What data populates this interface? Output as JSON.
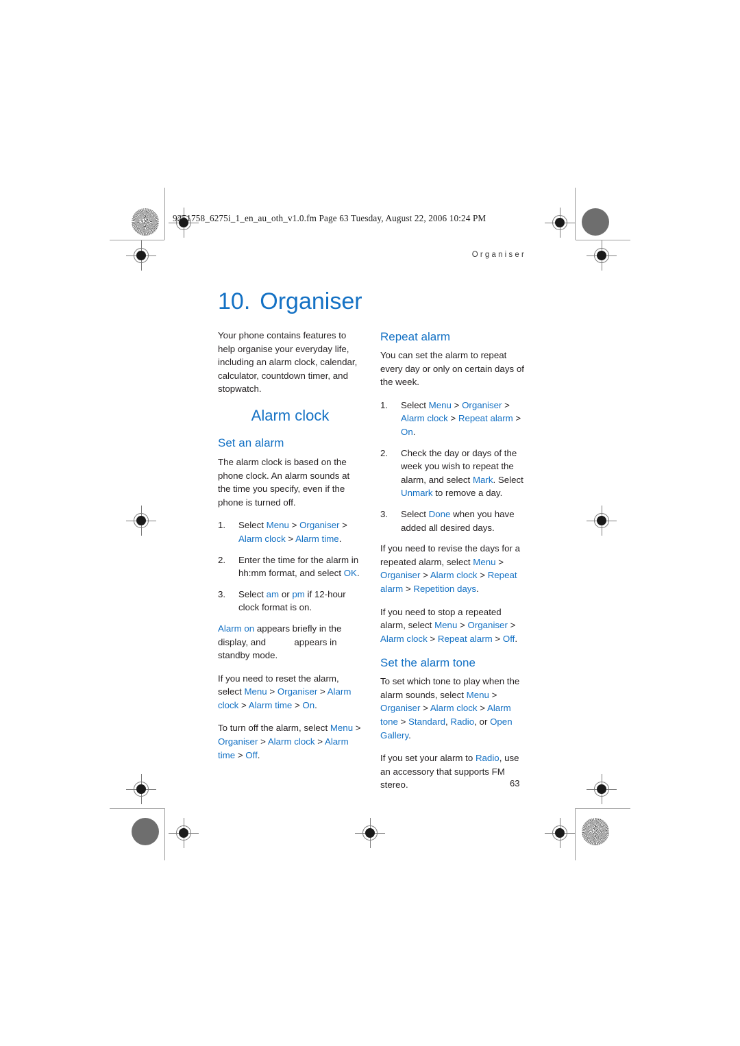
{
  "print_header": {
    "filename_line": "9251758_6275i_1_en_au_oth_v1.0.fm  Page 63  Tuesday, August 22, 2006  10:24 PM",
    "running_head": "Organiser"
  },
  "chapter": {
    "number": "10.",
    "title": "Organiser"
  },
  "left_column": {
    "intro": "Your phone contains features to help organise your everyday life, including an alarm clock, calendar, calculator, countdown timer, and stopwatch.",
    "section_heading": "Alarm clock",
    "sub_heading": "Set an alarm",
    "lead_paragraph": "The alarm clock is based on the phone clock. An alarm sounds at the time you specify, even if the phone is turned off.",
    "steps": [
      {
        "marker": "1.",
        "parts": [
          {
            "text": "Select ",
            "ui": false
          },
          {
            "text": "Menu",
            "ui": true
          },
          {
            "text": " > ",
            "ui": false
          },
          {
            "text": "Organiser",
            "ui": true
          },
          {
            "text": " > ",
            "ui": false
          },
          {
            "text": "Alarm clock",
            "ui": true
          },
          {
            "text": " > ",
            "ui": false
          },
          {
            "text": "Alarm time",
            "ui": true
          },
          {
            "text": ".",
            "ui": false
          }
        ]
      },
      {
        "marker": "2.",
        "parts": [
          {
            "text": "Enter the time for the alarm in hh:mm format, and select ",
            "ui": false
          },
          {
            "text": "OK",
            "ui": true
          },
          {
            "text": ".",
            "ui": false
          }
        ]
      },
      {
        "marker": "3.",
        "parts": [
          {
            "text": "Select ",
            "ui": false
          },
          {
            "text": "am",
            "ui": true
          },
          {
            "text": " or ",
            "ui": false
          },
          {
            "text": "pm",
            "ui": true
          },
          {
            "text": " if 12-hour clock format is on.",
            "ui": false
          }
        ]
      }
    ],
    "note_paragraph": [
      {
        "text": "Alarm on",
        "ui": true
      },
      {
        "text": " appears briefly in the display, and ",
        "ui": false
      },
      {
        "text": "",
        "ui": false,
        "icon_gap": true
      },
      {
        "text": " appears in standby mode.",
        "ui": false
      }
    ],
    "reset_paragraph": [
      {
        "text": "If you need to reset the alarm, select ",
        "ui": false
      },
      {
        "text": "Menu",
        "ui": true
      },
      {
        "text": " > ",
        "ui": false
      },
      {
        "text": "Organiser",
        "ui": true
      },
      {
        "text": " > ",
        "ui": false
      },
      {
        "text": "Alarm clock",
        "ui": true
      },
      {
        "text": " > ",
        "ui": false
      },
      {
        "text": "Alarm time",
        "ui": true
      },
      {
        "text": " > ",
        "ui": false
      },
      {
        "text": "On",
        "ui": true
      },
      {
        "text": ".",
        "ui": false
      }
    ],
    "turnoff_paragraph": [
      {
        "text": "To turn off the alarm, select ",
        "ui": false
      },
      {
        "text": "Menu",
        "ui": true
      },
      {
        "text": " > ",
        "ui": false
      },
      {
        "text": "Organiser",
        "ui": true
      },
      {
        "text": " > ",
        "ui": false
      },
      {
        "text": "Alarm clock",
        "ui": true
      },
      {
        "text": " > ",
        "ui": false
      },
      {
        "text": "Alarm time",
        "ui": true
      },
      {
        "text": " > ",
        "ui": false
      },
      {
        "text": "Off",
        "ui": true
      },
      {
        "text": ".",
        "ui": false
      }
    ]
  },
  "right_column": {
    "repeat_heading": "Repeat alarm",
    "repeat_intro": "You can set the alarm to repeat every day or only on certain days of the week.",
    "repeat_steps": [
      {
        "marker": "1.",
        "parts": [
          {
            "text": "Select ",
            "ui": false
          },
          {
            "text": "Menu",
            "ui": true
          },
          {
            "text": " > ",
            "ui": false
          },
          {
            "text": "Organiser",
            "ui": true
          },
          {
            "text": " > ",
            "ui": false
          },
          {
            "text": "Alarm clock",
            "ui": true
          },
          {
            "text": " > ",
            "ui": false
          },
          {
            "text": "Repeat alarm",
            "ui": true
          },
          {
            "text": " > ",
            "ui": false
          },
          {
            "text": "On",
            "ui": true
          },
          {
            "text": ".",
            "ui": false
          }
        ]
      },
      {
        "marker": "2.",
        "parts": [
          {
            "text": "Check the day or days of the week you wish to repeat the alarm, and select ",
            "ui": false
          },
          {
            "text": "Mark",
            "ui": true
          },
          {
            "text": ". Select ",
            "ui": false
          },
          {
            "text": "Unmark",
            "ui": true
          },
          {
            "text": " to remove a day.",
            "ui": false
          }
        ]
      },
      {
        "marker": "3.",
        "parts": [
          {
            "text": "Select ",
            "ui": false
          },
          {
            "text": "Done",
            "ui": true
          },
          {
            "text": " when you have added all desired days.",
            "ui": false
          }
        ]
      }
    ],
    "revise_paragraph": [
      {
        "text": "If you need to revise the days for a repeated alarm, select ",
        "ui": false
      },
      {
        "text": "Menu",
        "ui": true
      },
      {
        "text": " > ",
        "ui": false
      },
      {
        "text": "Organiser",
        "ui": true
      },
      {
        "text": " > ",
        "ui": false
      },
      {
        "text": "Alarm clock",
        "ui": true
      },
      {
        "text": " > ",
        "ui": false
      },
      {
        "text": "Repeat alarm",
        "ui": true
      },
      {
        "text": " > ",
        "ui": false
      },
      {
        "text": "Repetition days",
        "ui": true
      },
      {
        "text": ".",
        "ui": false
      }
    ],
    "stop_paragraph": [
      {
        "text": "If you need to stop a repeated alarm, select ",
        "ui": false
      },
      {
        "text": "Menu",
        "ui": true
      },
      {
        "text": " > ",
        "ui": false
      },
      {
        "text": "Organiser",
        "ui": true
      },
      {
        "text": " > ",
        "ui": false
      },
      {
        "text": "Alarm clock",
        "ui": true
      },
      {
        "text": " > ",
        "ui": false
      },
      {
        "text": "Repeat alarm",
        "ui": true
      },
      {
        "text": " > ",
        "ui": false
      },
      {
        "text": "Off",
        "ui": true
      },
      {
        "text": ".",
        "ui": false
      }
    ],
    "tone_heading": "Set the alarm tone",
    "tone_paragraph": [
      {
        "text": "To set which tone to play when the alarm sounds, select ",
        "ui": false
      },
      {
        "text": "Menu",
        "ui": true
      },
      {
        "text": " > ",
        "ui": false
      },
      {
        "text": "Organiser",
        "ui": true
      },
      {
        "text": " > ",
        "ui": false
      },
      {
        "text": "Alarm clock",
        "ui": true
      },
      {
        "text": " > ",
        "ui": false
      },
      {
        "text": "Alarm tone",
        "ui": true
      },
      {
        "text": " > ",
        "ui": false
      },
      {
        "text": "Standard",
        "ui": true
      },
      {
        "text": ", ",
        "ui": false
      },
      {
        "text": "Radio",
        "ui": true
      },
      {
        "text": ", or ",
        "ui": false
      },
      {
        "text": "Open Gallery",
        "ui": true
      },
      {
        "text": ".",
        "ui": false
      }
    ],
    "radio_paragraph": [
      {
        "text": "If you set your alarm to ",
        "ui": false
      },
      {
        "text": "Radio",
        "ui": true
      },
      {
        "text": ", use an accessory that supports FM stereo.",
        "ui": false
      }
    ]
  },
  "footer": {
    "page_number": "63"
  },
  "colors": {
    "accent_blue": "#1471c4",
    "body_text": "#231f20",
    "regmark_gray": "#7a7a7a"
  }
}
